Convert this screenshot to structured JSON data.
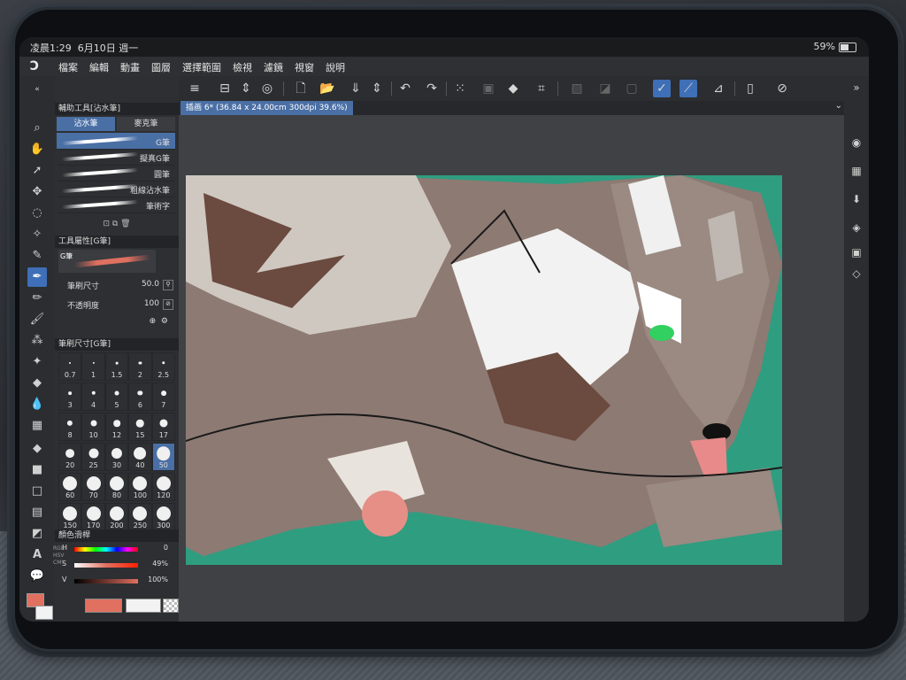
{
  "status": {
    "time": "凌晨1:29",
    "date": "6月10日 週一",
    "battery": "59%"
  },
  "menu": {
    "items": [
      "檔案",
      "編輯",
      "動畫",
      "圖層",
      "選擇範圍",
      "檢視",
      "濾鏡",
      "視窗",
      "說明"
    ]
  },
  "document": {
    "tab": "插画 6* (36.84 x 24.00cm 300dpi 39.6%)"
  },
  "subtool": {
    "header": "輔助工具[沾水筆]",
    "tabs": [
      "沾水筆",
      "麥克筆"
    ],
    "brushes": [
      {
        "label": "G筆"
      },
      {
        "label": "擬真G筆"
      },
      {
        "label": "圓筆"
      },
      {
        "label": "粗線沾水筆"
      },
      {
        "label": "筆術字"
      }
    ]
  },
  "tool_property": {
    "header": "工具屬性[G筆]",
    "brush_name": "G筆",
    "size_label": "筆刷尺寸",
    "size_value": "50.0",
    "opacity_label": "不透明度",
    "opacity_value": "100"
  },
  "brush_size": {
    "header": "筆刷尺寸[G筆]",
    "values": [
      "0.7",
      "1",
      "1.5",
      "2",
      "2.5",
      "3",
      "4",
      "5",
      "6",
      "7",
      "8",
      "10",
      "12",
      "15",
      "17",
      "20",
      "25",
      "30",
      "40",
      "50",
      "60",
      "70",
      "80",
      "100",
      "120",
      "150",
      "170",
      "200",
      "250",
      "300"
    ],
    "selected": "50"
  },
  "color_slider": {
    "header": "顏色滑桿",
    "h_label": "H",
    "h_value": "0",
    "s_label": "S",
    "s_value": "49%",
    "v_label": "V",
    "v_value": "100%",
    "side_labels": [
      "RGB",
      "HSV",
      "CMY"
    ]
  },
  "colors": {
    "main": "#e07060",
    "sub": "#f2f2f2",
    "accent": "#4a6fa5"
  }
}
